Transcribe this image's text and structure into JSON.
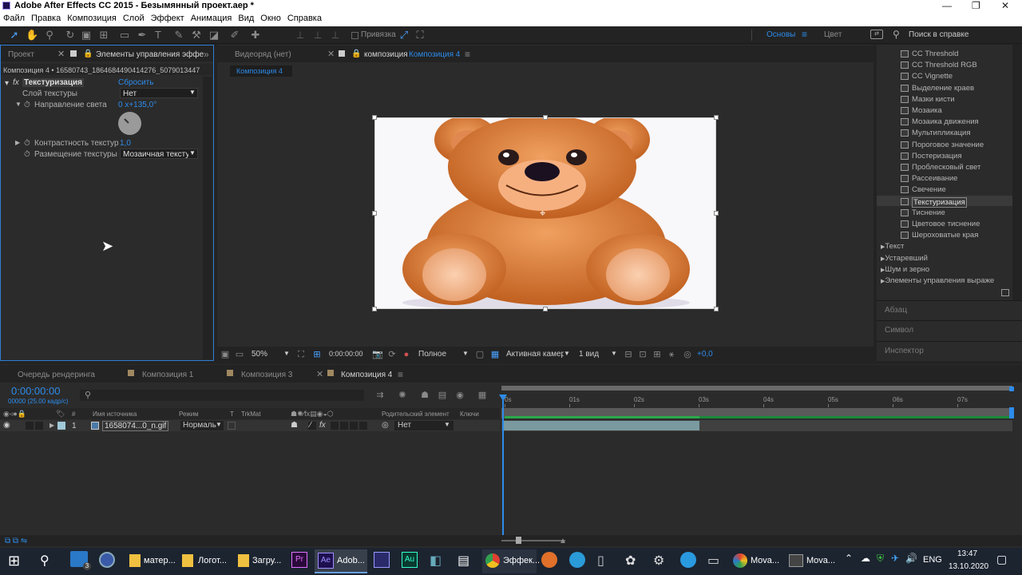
{
  "window": {
    "title": "Adobe After Effects CC 2015 - Безымянный проект.aep *"
  },
  "menu": [
    "Файл",
    "Правка",
    "Композиция",
    "Слой",
    "Эффект",
    "Анимация",
    "Вид",
    "Окно",
    "Справка"
  ],
  "toolbar": {
    "snap_label": "Привязка",
    "workspace_main": "Основы",
    "workspace_color": "Цвет",
    "search_placeholder": "Поиск в справке"
  },
  "left_panel": {
    "tab_project": "Проект",
    "tab_effects": "Элементы управления эффе",
    "header": "Композиция 4 • 16580743_1864684490414276_5079013447",
    "effect_name": "Текстуризация",
    "reset_label": "Сбросить",
    "props": [
      {
        "label": "Слой текстуры",
        "value": "Нет"
      },
      {
        "label": "Направление света",
        "value": "0 x+135,0°"
      },
      {
        "label": "Контрастность текстур",
        "value": "1,0"
      },
      {
        "label": "Размещение текстуры",
        "value": "Мозаичная текстура"
      }
    ]
  },
  "viewer": {
    "tab_footage": "Видеоряд (нет)",
    "tab_comp_prefix": "композиция",
    "tab_comp_name": "Композиция 4",
    "breadcrumb": "Композиция 4",
    "zoom": "50%",
    "timecode": "0:00:00:00",
    "resolution": "Полное",
    "camera": "Активная камера",
    "views": "1 вид",
    "exposure": "+0,0"
  },
  "effects_panel": {
    "items": [
      "CC Threshold",
      "CC Threshold RGB",
      "CC Vignette",
      "Выделение краев",
      "Мазки кисти",
      "Мозаика",
      "Мозаика движения",
      "Мультипликация",
      "Пороговое значение",
      "Постеризация",
      "Проблесковый свет",
      "Рассеивание",
      "Свечение",
      "Текстуризация",
      "Тиснение",
      "Цветовое тиснение",
      "Шероховатые края"
    ],
    "selected": "Текстуризация",
    "categories": [
      "Текст",
      "Устаревший",
      "Шум и зерно",
      "Элементы управления выраже"
    ],
    "panels": [
      "Абзац",
      "Символ",
      "Инспектор"
    ]
  },
  "timeline": {
    "tabs": [
      "Очередь рендеринга",
      "Композиция 1",
      "Композиция 3",
      "Композиция 4"
    ],
    "timecode": "0:00:00:00",
    "frame_info": "00000 (25.00 кадр/с)",
    "columns": {
      "source": "Имя источника",
      "mode": "Режим",
      "t": "T",
      "trkmat": "TrkMat",
      "parent": "Родительский элемент",
      "keys": "Ключи",
      "number": "#"
    },
    "layer": {
      "index": "1",
      "name": "1658074...0_n.gif",
      "mode": "Нормаль",
      "parent": "Нет"
    },
    "ruler": [
      "0s",
      "01s",
      "02s",
      "03s",
      "04s",
      "05s",
      "06s",
      "07s"
    ]
  },
  "taskbar": {
    "items": [
      {
        "label": "матер...",
        "icon": "folder-icon"
      },
      {
        "label": "Логот...",
        "icon": "folder-icon"
      },
      {
        "label": "Загру...",
        "icon": "folder-icon"
      },
      {
        "label": "Adob...",
        "icon": "after-effects-icon"
      },
      {
        "label": "Эффек...",
        "icon": "chrome-icon"
      },
      {
        "label": "Mova...",
        "icon": "movavi-icon"
      },
      {
        "label": "Mova...",
        "icon": "movavi-video-icon"
      }
    ],
    "badge": "3",
    "lang": "ENG",
    "time": "13:47",
    "date": "13.10.2020"
  },
  "colors": {
    "accent": "#2d8ceb",
    "panel": "#2b2b2b",
    "bg": "#232323",
    "layer_bar": "#7a9aa0",
    "work_area": "#1a8a3a"
  }
}
